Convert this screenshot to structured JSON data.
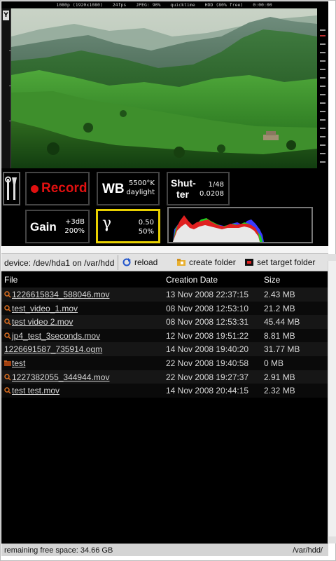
{
  "osd": {
    "resolution": "1080p (1920x1080)",
    "fps": "24fps",
    "format": "JPEG: 90%",
    "container": "quicktime",
    "hdd": "HDD (80% free)",
    "timecode": "0:00:00"
  },
  "side_meter_label": "Y",
  "controls": {
    "record_label": "Record",
    "wb": {
      "label": "WB",
      "value": "5500°K",
      "mode": "daylight"
    },
    "shutter": {
      "label_line1": "Shut-",
      "label_line2": "ter",
      "fraction": "1/48",
      "seconds": "0.0208"
    },
    "gain": {
      "label": "Gain",
      "db": "+3dB",
      "percent": "200%"
    },
    "gamma": {
      "label": "γ",
      "value": "0.50",
      "percent": "50%"
    },
    "record_color": "#e01010",
    "gamma_highlight_color": "#e8d000"
  },
  "browser": {
    "device": "device: /dev/hda1 on /var/hdd",
    "reload_label": "reload",
    "create_folder_label": "create folder",
    "set_target_label": "set target folder",
    "columns": [
      "File",
      "Creation Date",
      "Size"
    ],
    "rows": [
      {
        "name": "1226615834_588046.mov",
        "date": "13 Nov 2008 22:37:15",
        "size": "2.43 MB",
        "icon": "video-file-icon"
      },
      {
        "name": "test_video_1.mov",
        "date": "08 Nov 2008 12:53:10",
        "size": "21.2 MB",
        "icon": "video-file-icon"
      },
      {
        "name": "test video 2.mov",
        "date": "08 Nov 2008 12:53:31",
        "size": "45.44 MB",
        "icon": "video-file-icon"
      },
      {
        "name": "jp4_test_3seconds.mov",
        "date": "12 Nov 2008 19:51:22",
        "size": "8.81 MB",
        "icon": "video-file-icon"
      },
      {
        "name": "1226691587_735914.ogm",
        "date": "14 Nov 2008 19:40:20",
        "size": "31.77 MB",
        "icon": ""
      },
      {
        "name": "test",
        "date": "22 Nov 2008 19:40:58",
        "size": "0 MB",
        "icon": "folder-icon"
      },
      {
        "name": "1227382055_344944.mov",
        "date": "22 Nov 2008 19:27:37",
        "size": "2.91 MB",
        "icon": "video-file-icon"
      },
      {
        "name": "test test.mov",
        "date": "14 Nov 2008 20:44:15",
        "size": "2.32 MB",
        "icon": "video-file-icon"
      }
    ]
  },
  "status": {
    "free_space": "remaining free space: 34.66 GB",
    "path": "/var/hdd/"
  }
}
